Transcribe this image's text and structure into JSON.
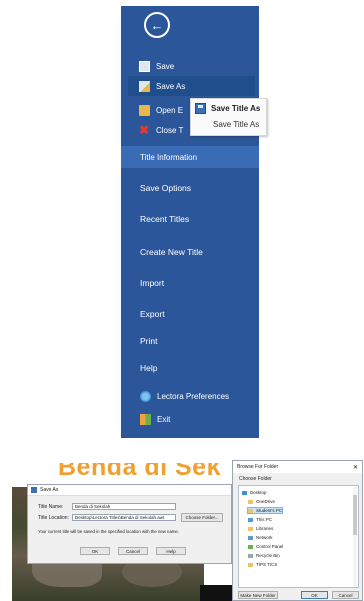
{
  "backstage": {
    "items": {
      "save": "Save",
      "save_as": "Save As",
      "open": "Open E",
      "close": "Close T",
      "title_information": "Title Information",
      "save_options": "Save Options",
      "recent_titles": "Recent Titles",
      "create_new_title": "Create New Title",
      "import": "Import",
      "export": "Export",
      "print": "Print",
      "help": "Help",
      "lectora_preferences": "Lectora Preferences",
      "exit": "Exit"
    },
    "colors": {
      "panel": "#2b579a",
      "selected": "#1f4e8c",
      "highlight": "#3a6bb5"
    }
  },
  "save_as_popup": {
    "primary": "Save Title As",
    "secondary": "Save Title As"
  },
  "background": {
    "title_text": "Benda di Sek"
  },
  "save_as_dialog": {
    "title": "Save As",
    "title_name_label": "Title Name:",
    "title_name_value": "Benda di Sekolah",
    "title_location_label": "Title Location:",
    "title_location_value": "Desktop\\Lectora Titles\\Benda di Sekolah.awt",
    "choose_folder_button": "Choose Folder...",
    "note": "Your current title will be saved in the specified location with the new name.",
    "ok_button": "OK",
    "cancel_button": "Cancel",
    "help_button": "Help"
  },
  "browse_dialog": {
    "title": "Browse For Folder",
    "instruction": "Choose Folder",
    "tree": [
      "Desktop",
      "OneDrive",
      "Student's PC",
      "This PC",
      "Libraries",
      "Network",
      "Control Panel",
      "Recycle Bin",
      "TIPS TICS"
    ],
    "make_new_folder_button": "Make New Folder",
    "ok_button": "OK",
    "cancel_button": "Cancel"
  }
}
